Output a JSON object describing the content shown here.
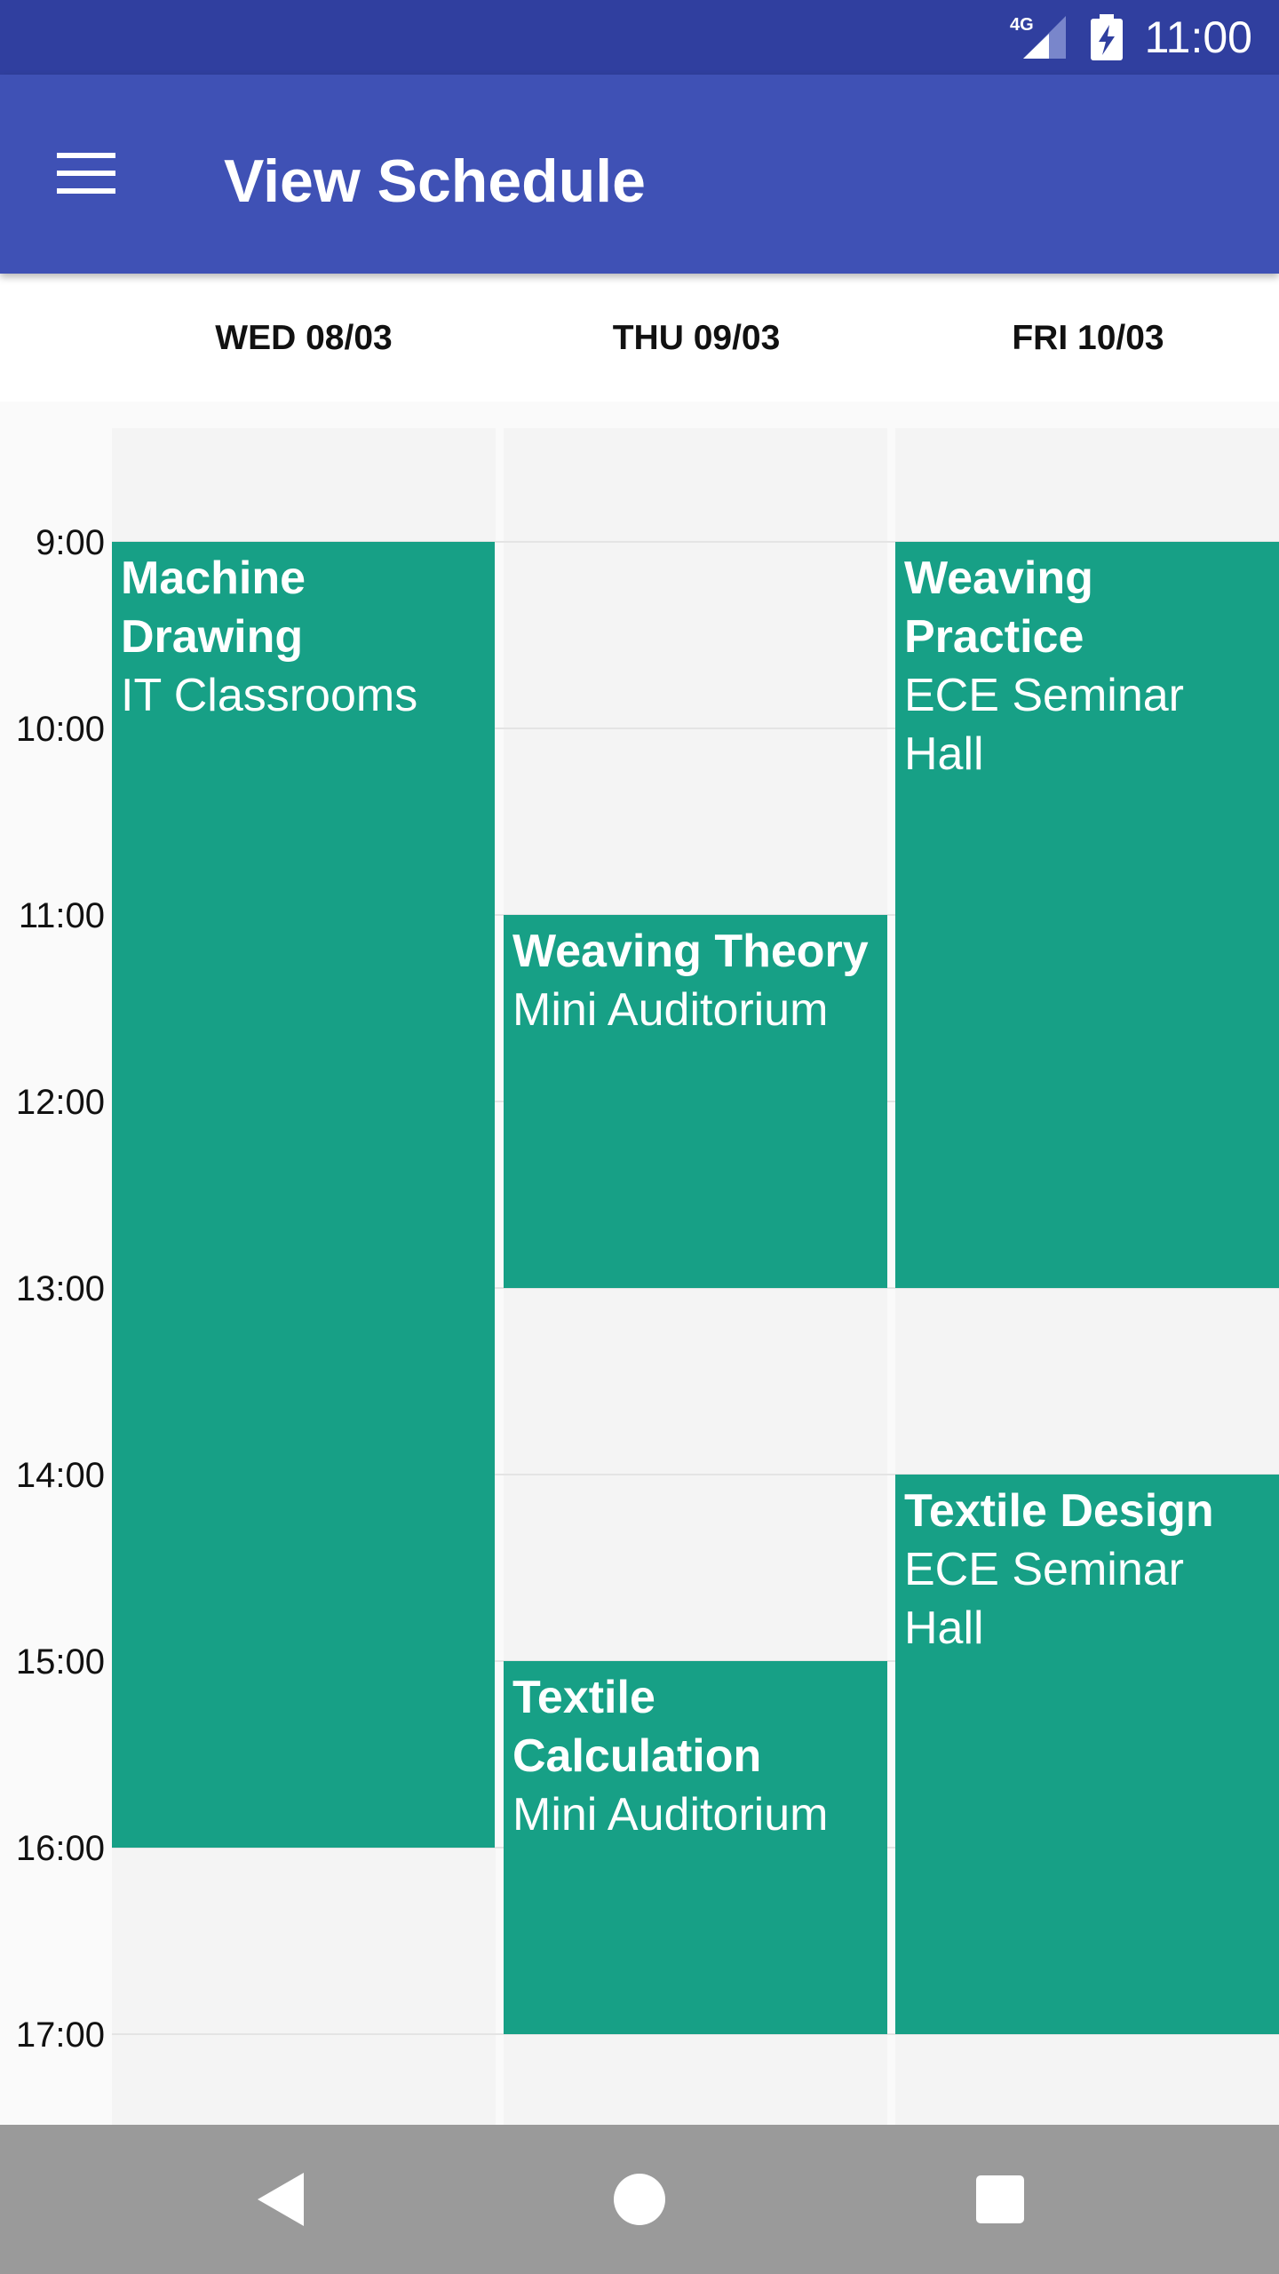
{
  "status_bar": {
    "clock": "11:00",
    "network_label": "4G",
    "icons": [
      "signal-4g-icon",
      "battery-charging-icon"
    ]
  },
  "app_bar": {
    "title": "View Schedule",
    "menu_icon": "hamburger-menu-icon"
  },
  "days": [
    {
      "label": "WED 08/03"
    },
    {
      "label": "THU 09/03"
    },
    {
      "label": "FRI 10/03"
    }
  ],
  "time_slots": [
    "9:00",
    "10:00",
    "11:00",
    "12:00",
    "13:00",
    "14:00",
    "15:00",
    "16:00",
    "17:00"
  ],
  "events": [
    {
      "day": 0,
      "start": "9:00",
      "end": "16:00",
      "title": "Machine Drawing",
      "location": "IT Classrooms"
    },
    {
      "day": 1,
      "start": "11:00",
      "end": "13:00",
      "title": "Weaving Theory",
      "location": "Mini Auditorium"
    },
    {
      "day": 1,
      "start": "15:00",
      "end": "17:00",
      "title": "Textile Calculation",
      "location": "Mini Auditorium"
    },
    {
      "day": 2,
      "start": "9:00",
      "end": "13:00",
      "title": "Weaving Practice",
      "location": "ECE Seminar Hall"
    },
    {
      "day": 2,
      "start": "14:00",
      "end": "17:00",
      "title": "Textile Design",
      "location": "ECE Seminar Hall"
    }
  ],
  "colors": {
    "status_bar": "#303f9f",
    "app_bar": "#3f51b5",
    "event": "#17a086",
    "nav_bar": "#9a9a9a"
  },
  "nav_bar": {
    "buttons": [
      "back-icon",
      "home-icon",
      "recents-icon"
    ]
  }
}
